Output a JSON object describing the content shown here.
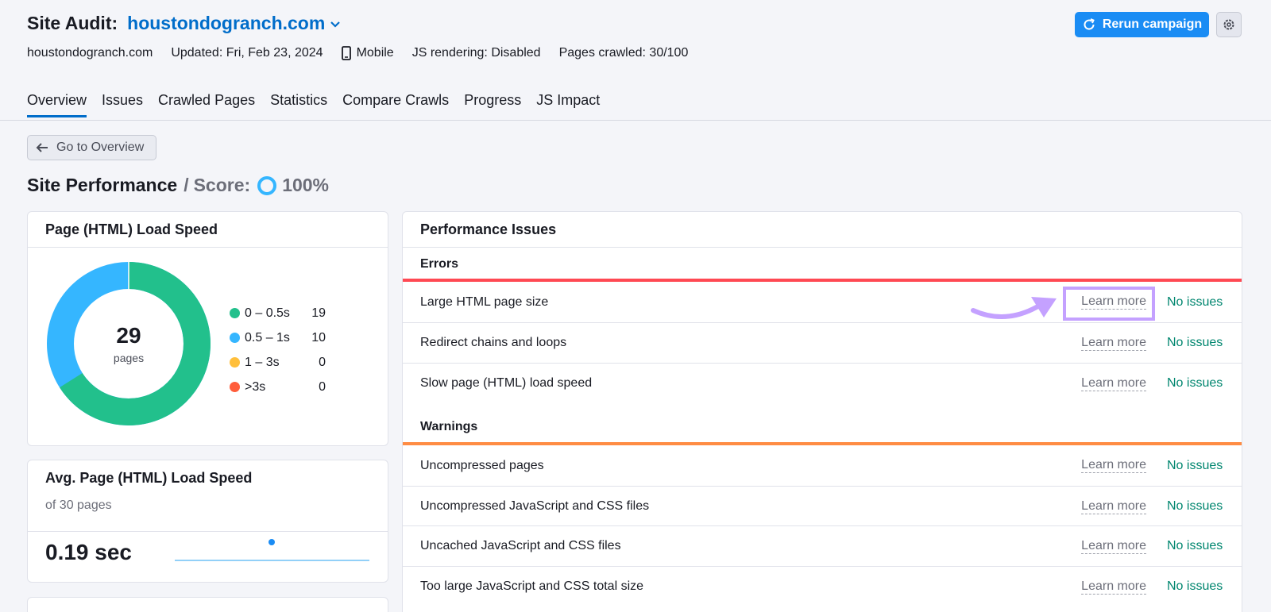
{
  "header": {
    "title_label": "Site Audit:",
    "domain": "houstondogranch.com",
    "meta_domain": "houstondogranch.com",
    "updated": "Updated: Fri, Feb 23, 2024",
    "device": "Mobile",
    "js_rendering": "JS rendering: Disabled",
    "pages_crawled": "Pages crawled: 30/100",
    "rerun_label": "Rerun campaign",
    "accent_color": "#1a8cf4"
  },
  "tabs": [
    {
      "label": "Overview",
      "active": true
    },
    {
      "label": "Issues"
    },
    {
      "label": "Crawled Pages"
    },
    {
      "label": "Statistics"
    },
    {
      "label": "Compare Crawls"
    },
    {
      "label": "Progress"
    },
    {
      "label": "JS Impact"
    }
  ],
  "back_button": "Go to Overview",
  "performance": {
    "title": "Site Performance",
    "sep": "/",
    "score_label": "Score:",
    "score": "100%"
  },
  "load_speed_card": {
    "title": "Page (HTML) Load Speed",
    "center_value": "29",
    "center_label": "pages",
    "legend": [
      {
        "label": "0 – 0.5s",
        "value": "19",
        "color": "#22c08c"
      },
      {
        "label": "0.5 – 1s",
        "value": "10",
        "color": "#35b6ff"
      },
      {
        "label": "1 – 3s",
        "value": "0",
        "color": "#ffbf3b"
      },
      {
        "label": ">3s",
        "value": "0",
        "color": "#ff5d3b"
      }
    ]
  },
  "avg_card": {
    "title": "Avg. Page (HTML) Load Speed",
    "subtitle": "of 30 pages",
    "value": "0.19 sec"
  },
  "issues_card": {
    "title": "Performance Issues",
    "errors_label": "Errors",
    "warnings_label": "Warnings",
    "learn_more": "Learn more",
    "status": "No issues",
    "errors": [
      "Large HTML page size",
      "Redirect chains and loops",
      "Slow page (HTML) load speed"
    ],
    "warnings": [
      "Uncompressed pages",
      "Uncompressed JavaScript and CSS files",
      "Uncached JavaScript and CSS files",
      "Too large JavaScript and CSS total size"
    ]
  }
}
